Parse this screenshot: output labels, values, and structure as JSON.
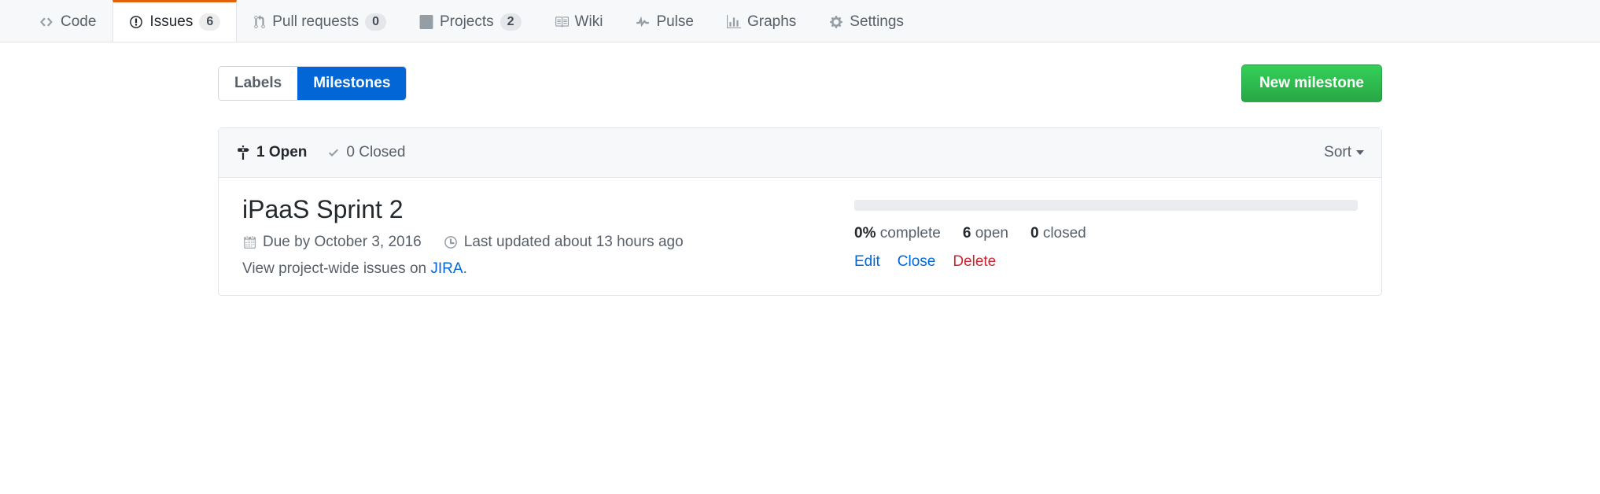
{
  "nav": {
    "code": "Code",
    "issues": "Issues",
    "issues_count": "6",
    "pulls": "Pull requests",
    "pulls_count": "0",
    "projects": "Projects",
    "projects_count": "2",
    "wiki": "Wiki",
    "pulse": "Pulse",
    "graphs": "Graphs",
    "settings": "Settings"
  },
  "subnav": {
    "labels": "Labels",
    "milestones": "Milestones",
    "new_milestone": "New milestone"
  },
  "filter": {
    "open": "1 Open",
    "closed": "0 Closed",
    "sort": "Sort"
  },
  "milestone": {
    "title": "iPaaS Sprint 2",
    "due": "Due by October 3, 2016",
    "updated": "Last updated about 13 hours ago",
    "desc_prefix": "View project-wide issues on ",
    "desc_link": "JIRA",
    "desc_suffix": ".",
    "percent": "0%",
    "complete_label": " complete",
    "open_n": "6",
    "open_label": " open",
    "closed_n": "0",
    "closed_label": " closed",
    "edit": "Edit",
    "close": "Close",
    "delete": "Delete"
  }
}
